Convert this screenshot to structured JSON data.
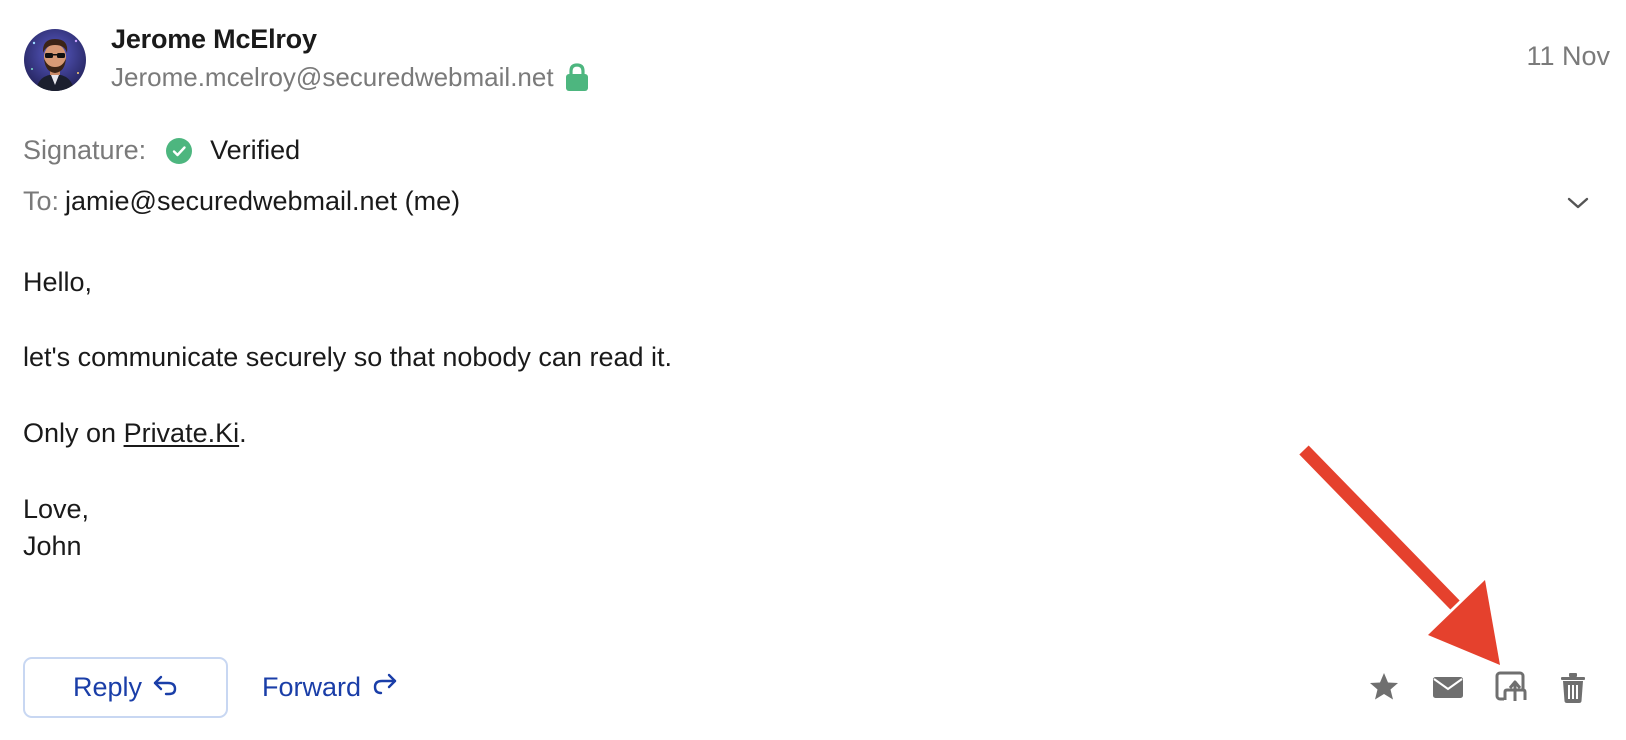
{
  "sender": {
    "name": "Jerome McElroy",
    "email": "Jerome.mcelroy@securedwebmail.net"
  },
  "date": "11 Nov",
  "signature": {
    "label": "Signature:",
    "status": "Verified"
  },
  "recipients": {
    "label": "To:",
    "value": "jamie@securedwebmail.net (me)"
  },
  "body": {
    "greeting": "Hello,",
    "line1": "let's communicate securely so that nobody can read it.",
    "line2_prefix": "Only on ",
    "line2_link": "Private.Ki",
    "line2_suffix": ".",
    "closing": "Love,",
    "signoff": "John"
  },
  "actions": {
    "reply_label": "Reply",
    "forward_label": "Forward",
    "icons": [
      "star-icon",
      "envelope-icon",
      "export-icon",
      "trash-icon"
    ]
  },
  "colors": {
    "accent": "#1a3ea8",
    "verified_green": "#4db67f",
    "muted_text": "#7a7a7a",
    "icon_gray": "#6f6f6f",
    "annotation_red": "#e5412d"
  }
}
